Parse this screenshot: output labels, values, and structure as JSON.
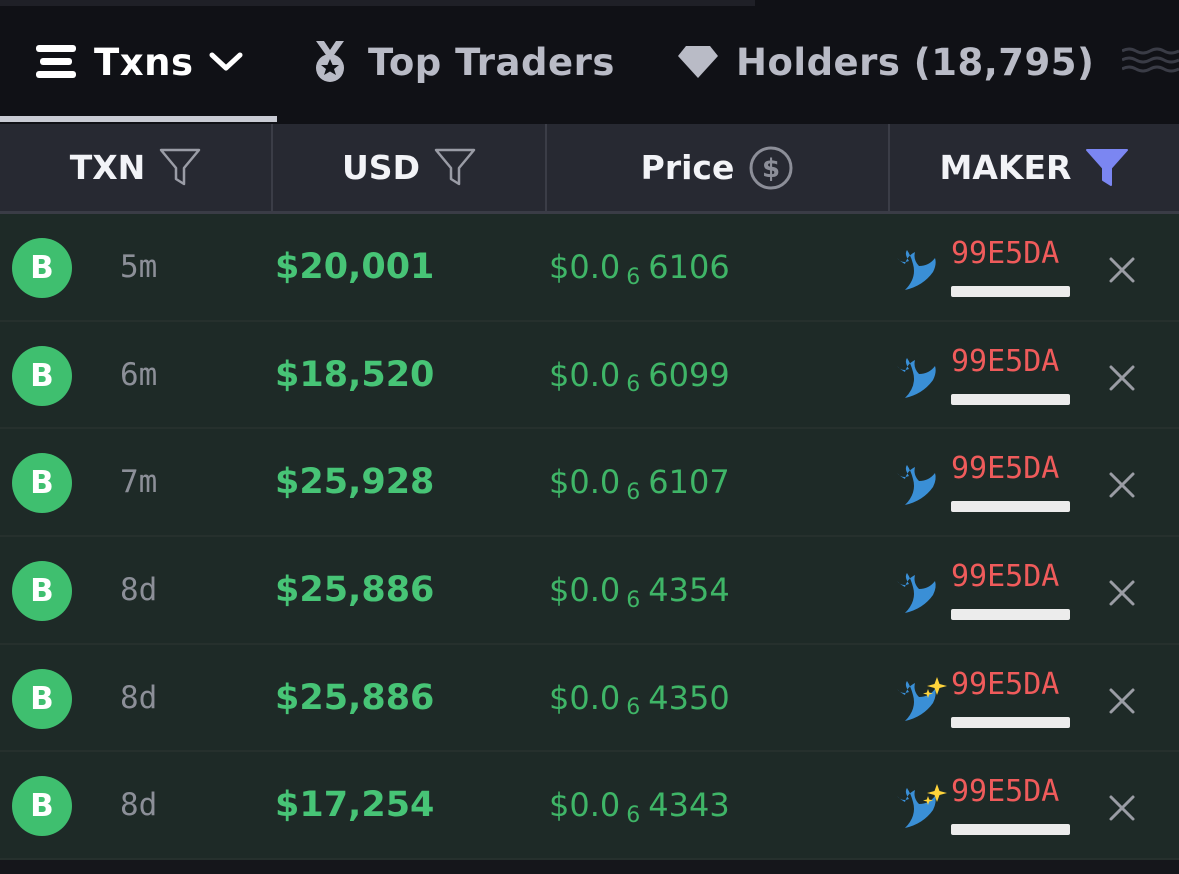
{
  "tabs": {
    "txns": "Txns",
    "top_traders": "Top Traders",
    "holders": "Holders (18,795)"
  },
  "columns": {
    "txn": "TXN",
    "usd": "USD",
    "price": "Price",
    "maker": "MAKER"
  },
  "colors": {
    "buy_badge": "#3fbf6f",
    "usd_text": "#47c476",
    "price_text": "#3fb567",
    "maker_text": "#ef5b5b",
    "active_filter": "#7b86f2"
  },
  "rows": [
    {
      "type": "B",
      "age": "5m",
      "usd": "$20,001",
      "price_prefix": "$0.0",
      "price_zeros": "6",
      "price_digits": "6106",
      "maker": "99E5DA",
      "maker_icon": "whale-icon"
    },
    {
      "type": "B",
      "age": "6m",
      "usd": "$18,520",
      "price_prefix": "$0.0",
      "price_zeros": "6",
      "price_digits": "6099",
      "maker": "99E5DA",
      "maker_icon": "whale-icon"
    },
    {
      "type": "B",
      "age": "7m",
      "usd": "$25,928",
      "price_prefix": "$0.0",
      "price_zeros": "6",
      "price_digits": "6107",
      "maker": "99E5DA",
      "maker_icon": "whale-icon"
    },
    {
      "type": "B",
      "age": "8d",
      "usd": "$25,886",
      "price_prefix": "$0.0",
      "price_zeros": "6",
      "price_digits": "4354",
      "maker": "99E5DA",
      "maker_icon": "whale-icon"
    },
    {
      "type": "B",
      "age": "8d",
      "usd": "$25,886",
      "price_prefix": "$0.0",
      "price_zeros": "6",
      "price_digits": "4350",
      "maker": "99E5DA",
      "maker_icon": "whale-sparkle-icon"
    },
    {
      "type": "B",
      "age": "8d",
      "usd": "$17,254",
      "price_prefix": "$0.0",
      "price_zeros": "6",
      "price_digits": "4343",
      "maker": "99E5DA",
      "maker_icon": "whale-sparkle-icon"
    }
  ]
}
